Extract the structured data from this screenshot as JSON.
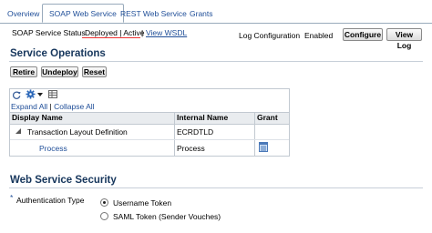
{
  "tabs": [
    {
      "label": "Overview",
      "active": false
    },
    {
      "label": "SOAP Web Service",
      "active": true
    },
    {
      "label": "REST Web Service",
      "active": false
    },
    {
      "label": "Grants",
      "active": false
    }
  ],
  "status": {
    "label": "SOAP Service Status",
    "value": "Deployed | Active",
    "separator": "|",
    "wsdl_link": "View WSDL",
    "log_config_label": "Log Configuration",
    "log_config_value": "Enabled",
    "configure_button": "Configure",
    "view_log_button": "View Log"
  },
  "service_operations": {
    "title": "Service Operations",
    "buttons": [
      "Retire",
      "Undeploy",
      "Reset"
    ],
    "expand_all": "Expand All",
    "collapse_all": "Collapse All",
    "columns": [
      "Display Name",
      "Internal Name",
      "Grant"
    ],
    "rows": [
      {
        "display_name": "Transaction Layout Definition",
        "internal_name": "ECRDTLD",
        "grant": ""
      },
      {
        "display_name": "Process",
        "internal_name": "Process",
        "grant": "grant-icon"
      }
    ]
  },
  "web_service_security": {
    "title": "Web Service Security",
    "required_marker": "*",
    "auth_label": "Authentication Type",
    "options": [
      {
        "label": "Username Token",
        "selected": true
      },
      {
        "label": "SAML Token (Sender Vouches)",
        "selected": false
      }
    ]
  },
  "colors": {
    "link": "#1f4e98",
    "section_title": "#16365c",
    "accent_underline": "#e33333"
  }
}
